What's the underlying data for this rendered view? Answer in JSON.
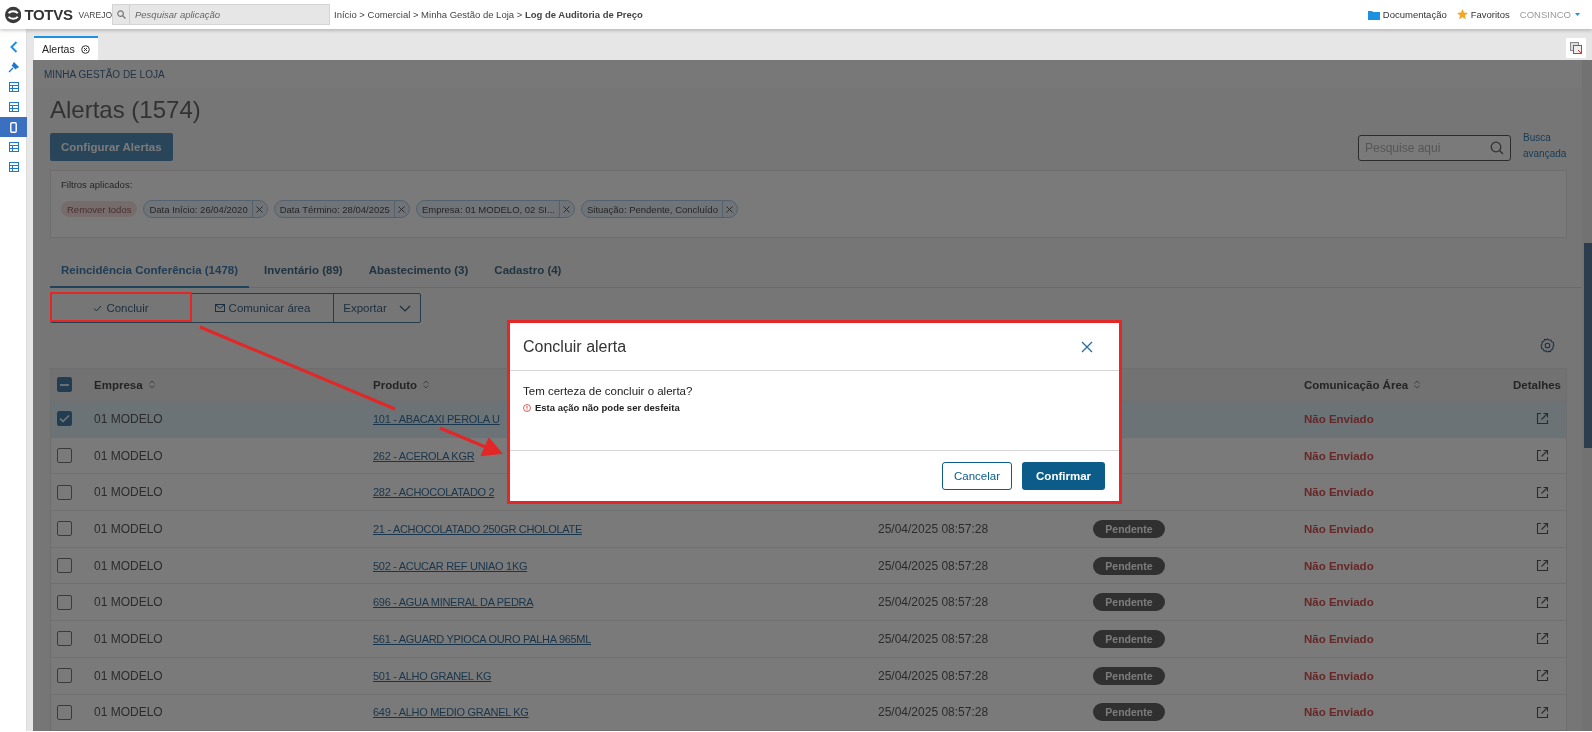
{
  "topbar": {
    "logo_text": "TOTVS",
    "logo_subtext": "VAREJO",
    "search": {
      "placeholder": "Pesquisar aplicação"
    },
    "breadcrumb": "Início > Comercial > Minha Gestão de Loja > **Log de Auditoria de Preço**",
    "links": [
      {
        "kind": "folder",
        "label": "Documentação"
      },
      {
        "kind": "star",
        "label": "Favoritos"
      }
    ],
    "user": "CONSINCO"
  },
  "sidebar": {
    "items": [
      {
        "kind": "back",
        "selected": false
      },
      {
        "kind": "pin",
        "selected": false
      },
      {
        "kind": "table",
        "selected": false
      },
      {
        "kind": "table",
        "selected": false
      },
      {
        "kind": "mobile",
        "selected": true
      },
      {
        "kind": "table",
        "selected": false
      },
      {
        "kind": "table",
        "selected": false
      }
    ]
  },
  "tabs": [
    {
      "label": "Alertas",
      "selected": true
    }
  ],
  "page": {
    "section": "MINHA GESTÃO DE LOJA",
    "title": "Alertas (1574)",
    "config_button": "Configurar Alertas",
    "search": {
      "placeholder": "Pesquise aqui"
    },
    "advanced_search": "Busca avançada"
  },
  "filters": {
    "label": "Filtros aplicados:",
    "clear": "Remover todos",
    "chips": [
      "Data Início: 26/04/2020",
      "Data Término: 28/04/2025",
      "Empresa: 01 MODELO, 02 SI...",
      "Situação: Pendente, Concluído"
    ]
  },
  "category_tabs": [
    {
      "label": "Reincidência Conferência (1478)",
      "selected": true
    },
    {
      "label": "Inventário (89)",
      "selected": false
    },
    {
      "label": "Abastecimento (3)",
      "selected": false
    },
    {
      "label": "Cadastro (4)",
      "selected": false
    }
  ],
  "actions": [
    {
      "kind": "check",
      "label": "Concluir"
    },
    {
      "kind": "mail",
      "label": "Comunicar área"
    },
    {
      "kind": "dropdown",
      "label": "Exportar"
    }
  ],
  "table": {
    "select_all_partial": true,
    "columns": [
      {
        "label": "Empresa",
        "sortable": true
      },
      {
        "label": "Produto",
        "sortable": true
      },
      {
        "label": "Comunicação Área",
        "sortable": true
      },
      {
        "label": "Detalhes",
        "sortable": false
      }
    ],
    "rows": [
      {
        "selected": true,
        "empresa": "01 MODELO",
        "produto": "101 - ABACAXI PEROLA U",
        "comunicacao": "Não Enviado"
      },
      {
        "selected": false,
        "empresa": "01 MODELO",
        "produto": "262 - ACEROLA KGR",
        "comunicacao": "Não Enviado"
      },
      {
        "selected": false,
        "empresa": "01 MODELO",
        "produto": "282 - ACHOCOLATADO 2",
        "comunicacao": "Não Enviado"
      },
      {
        "selected": false,
        "empresa": "01 MODELO",
        "produto": "21 - ACHOCOLATADO 250GR CHOLOLATE",
        "data": "25/04/2025 08:57:28",
        "situacao": "Pendente",
        "comunicacao": "Não Enviado"
      },
      {
        "selected": false,
        "empresa": "01 MODELO",
        "produto": "502 - ACUCAR REF UNIAO 1KG",
        "data": "25/04/2025 08:57:28",
        "situacao": "Pendente",
        "comunicacao": "Não Enviado"
      },
      {
        "selected": false,
        "empresa": "01 MODELO",
        "produto": "696 - AGUA MINERAL DA PEDRA",
        "data": "25/04/2025 08:57:28",
        "situacao": "Pendente",
        "comunicacao": "Não Enviado"
      },
      {
        "selected": false,
        "empresa": "01 MODELO",
        "produto": "561 - AGUARD YPIOCA OURO PALHA 965ML",
        "data": "25/04/2025 08:57:28",
        "situacao": "Pendente",
        "comunicacao": "Não Enviado"
      },
      {
        "selected": false,
        "empresa": "01 MODELO",
        "produto": "501 - ALHO GRANEL KG",
        "data": "25/04/2025 08:57:28",
        "situacao": "Pendente",
        "comunicacao": "Não Enviado"
      },
      {
        "selected": false,
        "empresa": "01 MODELO",
        "produto": "649 - ALHO MEDIO GRANEL KG",
        "data": "25/04/2025 08:57:28",
        "situacao": "Pendente",
        "comunicacao": "Não Enviado"
      }
    ]
  },
  "dialog": {
    "title": "Concluir alerta",
    "message": "Tem certeza de concluir o alerta?",
    "warning": "Esta ação não pode ser desfeita",
    "buttons": [
      {
        "kind": "secondary",
        "label": "Cancelar"
      },
      {
        "kind": "primary",
        "label": "Confirmar"
      }
    ]
  }
}
